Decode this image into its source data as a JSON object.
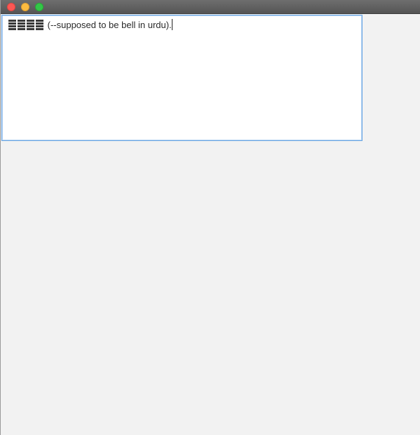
{
  "window": {
    "buttons": {
      "close_icon": "close-icon",
      "minimize_icon": "minimize-icon",
      "zoom_icon": "zoom-icon"
    }
  },
  "text_area": {
    "unrendered_glyphs": "الارم",
    "text": "(--supposed to be bell in urdu)."
  }
}
